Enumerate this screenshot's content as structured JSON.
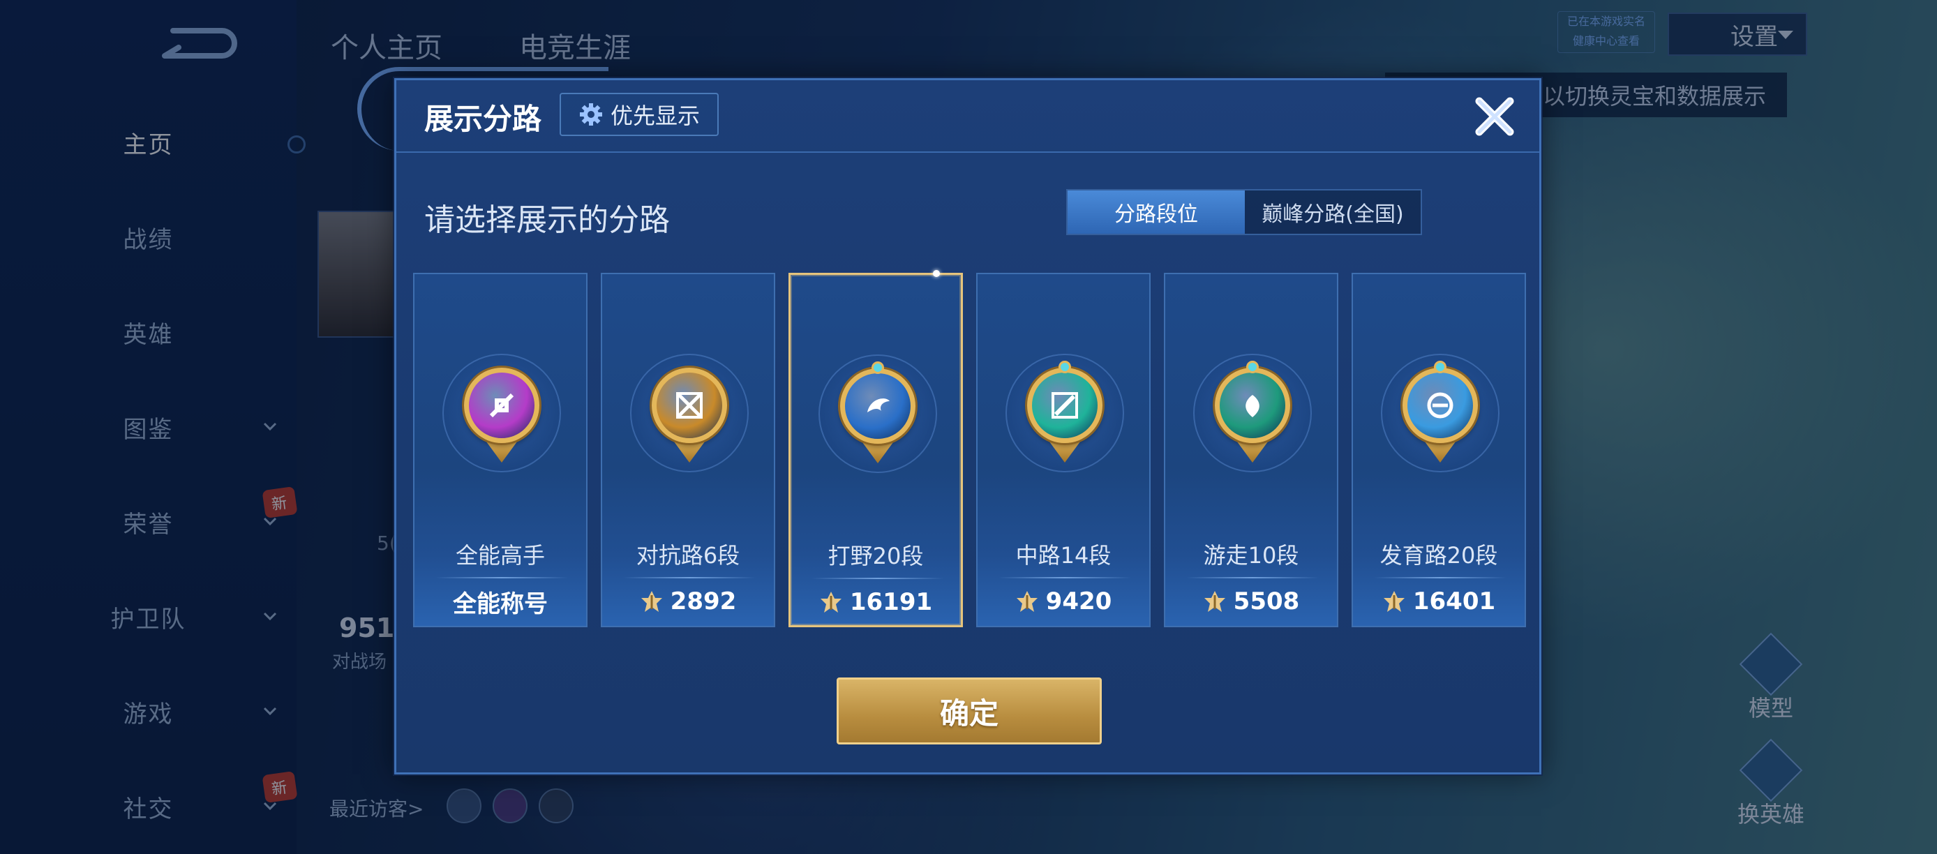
{
  "top_tabs": [
    "个人主页",
    "电竞生涯"
  ],
  "sidebar": {
    "items": [
      {
        "label": "主页",
        "active": true,
        "chevron": false,
        "badge": ""
      },
      {
        "label": "战绩",
        "active": false,
        "chevron": false,
        "badge": ""
      },
      {
        "label": "英雄",
        "active": false,
        "chevron": false,
        "badge": ""
      },
      {
        "label": "图鉴",
        "active": false,
        "chevron": true,
        "badge": ""
      },
      {
        "label": "荣誉",
        "active": false,
        "chevron": true,
        "badge": "新"
      },
      {
        "label": "护卫队",
        "active": false,
        "chevron": true,
        "badge": ""
      },
      {
        "label": "游戏",
        "active": false,
        "chevron": true,
        "badge": ""
      },
      {
        "label": "社交",
        "active": false,
        "chevron": true,
        "badge": "新"
      }
    ]
  },
  "settings": {
    "label": "设置"
  },
  "realname": {
    "line1": "已在本游戏实名",
    "line2": "健康中心查看"
  },
  "tip_bar": {
    "text": "以切换灵宝和数据展示"
  },
  "profile": {
    "partial_number": "951",
    "partial_sub": "对战场",
    "side_num": "5("
  },
  "visitors": {
    "label": "最近访客>"
  },
  "side_buttons": {
    "model": "模型",
    "change_hero": "换英雄"
  },
  "modal": {
    "title": "展示分路",
    "priority_label": "优先显示",
    "prompt": "请选择展示的分路",
    "segment": {
      "options": [
        "分路段位",
        "巅峰分路(全国)"
      ],
      "selected": 0
    },
    "cards": [
      {
        "name": "全能高手",
        "value": "全能称号",
        "has_icon": false,
        "selected": false,
        "color": "#b43cc8"
      },
      {
        "name": "对抗路6段",
        "value": "2892",
        "has_icon": true,
        "selected": false,
        "color": "#c98a2a"
      },
      {
        "name": "打野20段",
        "value": "16191",
        "has_icon": true,
        "selected": true,
        "color": "#2a6fc8"
      },
      {
        "name": "中路14段",
        "value": "9420",
        "has_icon": true,
        "selected": false,
        "color": "#1fb39a"
      },
      {
        "name": "游走10段",
        "value": "5508",
        "has_icon": true,
        "selected": false,
        "color": "#1e9a7c"
      },
      {
        "name": "发育路20段",
        "value": "16401",
        "has_icon": true,
        "selected": false,
        "color": "#3a9be0"
      }
    ],
    "confirm_label": "确定"
  }
}
